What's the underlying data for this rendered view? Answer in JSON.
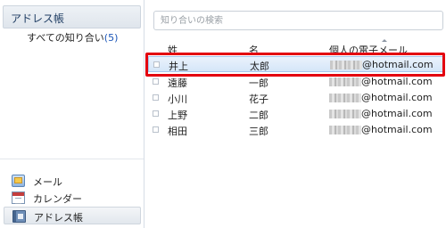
{
  "sidebar": {
    "title": "アドレス帳",
    "folder_label": "すべての知り合い",
    "folder_count": "5",
    "nav": [
      {
        "label": "メール",
        "icon": "mail-icon"
      },
      {
        "label": "カレンダー",
        "icon": "calendar-icon"
      },
      {
        "label": "アドレス帳",
        "icon": "address-book-icon"
      }
    ]
  },
  "search": {
    "placeholder": "知り合いの検索",
    "value": ""
  },
  "table": {
    "columns": [
      "姓",
      "名",
      "個人の電子メール"
    ],
    "rows": [
      {
        "last": "井上",
        "first": "太郎",
        "email": "@hotmail.com",
        "selected": true
      },
      {
        "last": "遠藤",
        "first": "一郎",
        "email": "@hotmail.com",
        "selected": false
      },
      {
        "last": "小川",
        "first": "花子",
        "email": "@hotmail.com",
        "selected": false
      },
      {
        "last": "上野",
        "first": "二郎",
        "email": "@hotmail.com",
        "selected": false
      },
      {
        "last": "相田",
        "first": "三郎",
        "email": "@hotmail.com",
        "selected": false
      }
    ]
  },
  "colors": {
    "highlight": "#e3000f",
    "selection": "#d5e6f8",
    "link": "#1b56b8"
  }
}
